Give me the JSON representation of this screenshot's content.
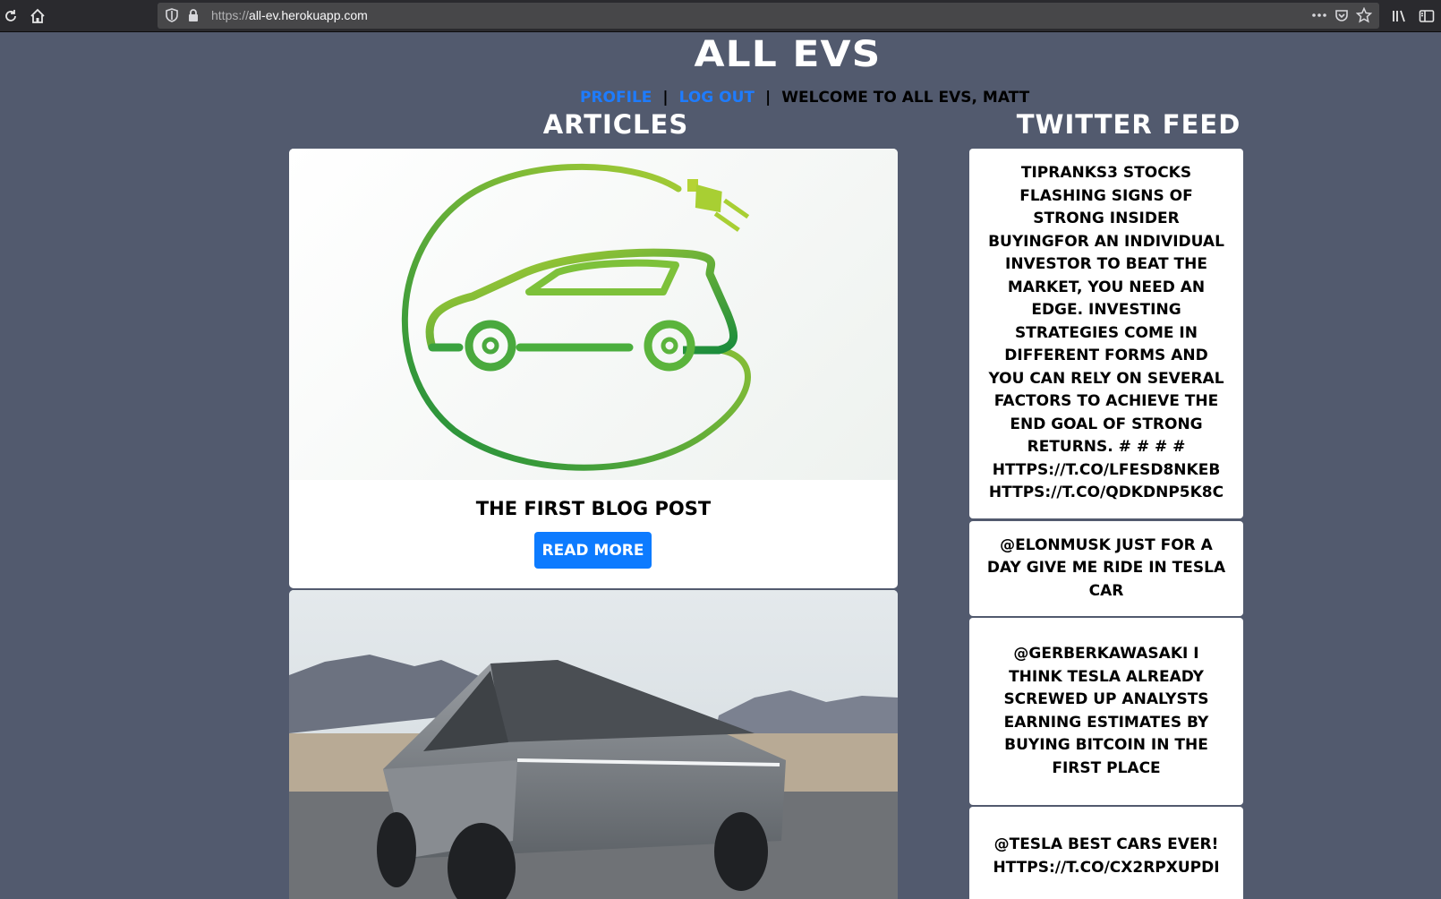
{
  "browser": {
    "url_protocol": "https://",
    "url_host": "all-ev.herokuapp.com",
    "icons": [
      "reload-icon",
      "home-icon",
      "shield-icon",
      "lock-icon",
      "more-icon",
      "pocket-icon",
      "bookmark-star-icon",
      "library-icon",
      "sidebar-icon"
    ]
  },
  "site": {
    "title": "All EVs"
  },
  "nav": {
    "profile": "Profile",
    "separator": "|",
    "logout": "Log Out",
    "welcome": "Welcome to All EVs, Matt"
  },
  "articles": {
    "heading": "Articles",
    "items": [
      {
        "title": "The First Blog Post",
        "button": "Read More",
        "image": "ev-car-plug-logo"
      },
      {
        "image": "tesla-cybertruck-photo"
      }
    ]
  },
  "twitter": {
    "heading": "Twitter Feed",
    "tweets": [
      "TipRanks3 Stocks Flashing Signs of Strong Insider BuyingFor an individual investor to beat the market, you need an edge. Investing strategies come in different forms and you can rely on several factors to achieve the end goal of strong returns. # # # # https://t.co/lFESD8NKEB https://t.co/QdkDnP5K8c",
      "@elonmusk just for a day give me ride in tesla car",
      "@GerberKawasaki I think Tesla already screwed up analysts earning estimates by buying Bitcoin in the first place",
      "@Tesla Best cars ever! https://t.co/cX2rPXUpdI"
    ]
  },
  "colors": {
    "page_bg": "#525a6e",
    "link": "#1e7cff",
    "button": "#0d7bff",
    "logo_green_light": "#b5d334",
    "logo_green_dark": "#1a8c3c"
  }
}
